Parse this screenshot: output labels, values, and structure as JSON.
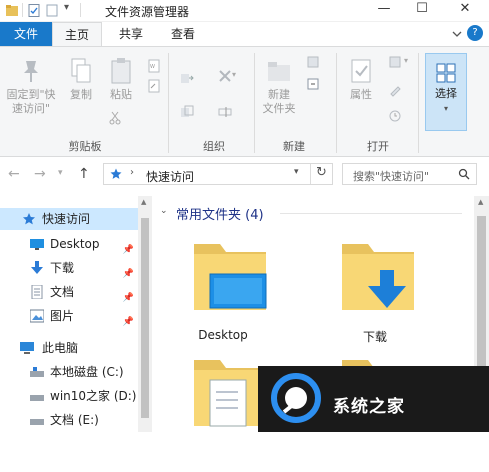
{
  "window": {
    "title": "文件资源管理器",
    "minimize": "—",
    "maximize": "☐",
    "close": "✕"
  },
  "tabs": {
    "file": "文件",
    "home": "主页",
    "share": "共享",
    "view": "查看",
    "help": "?"
  },
  "ribbon": {
    "clipboard": {
      "pin_label_1": "固定到\"快",
      "pin_label_2": "速访问\"",
      "copy_label": "复制",
      "paste_label": "粘贴",
      "group_label": "剪贴板"
    },
    "organize": {
      "group_label": "组织"
    },
    "new": {
      "new_folder_label_1": "新建",
      "new_folder_label_2": "文件夹",
      "group_label": "新建"
    },
    "open": {
      "properties_label": "属性",
      "group_label": "打开"
    },
    "select": {
      "select_label": "选择"
    }
  },
  "address": {
    "path": "快速访问",
    "search_placeholder": "搜索\"快速访问\""
  },
  "nav_pane": {
    "items": [
      {
        "label": "快速访问",
        "icon": "star-icon",
        "pinned": false
      },
      {
        "label": "Desktop",
        "icon": "desktop-icon",
        "pinned": true
      },
      {
        "label": "下载",
        "icon": "download-icon",
        "pinned": true
      },
      {
        "label": "文档",
        "icon": "document-icon",
        "pinned": true
      },
      {
        "label": "图片",
        "icon": "picture-icon",
        "pinned": true
      },
      {
        "label": "此电脑",
        "icon": "computer-icon",
        "pinned": false
      },
      {
        "label": "本地磁盘 (C:)",
        "icon": "drive-icon",
        "pinned": false
      },
      {
        "label": "win10之家 (D:)",
        "icon": "drive-icon",
        "pinned": false
      },
      {
        "label": "文档 (E:)",
        "icon": "drive-icon",
        "pinned": false
      }
    ]
  },
  "content": {
    "group_header": "常用文件夹 (4)",
    "folders": [
      {
        "label": "Desktop",
        "icon": "desktop-folder-icon"
      },
      {
        "label": "下载",
        "icon": "download-folder-icon"
      },
      {
        "label": "",
        "icon": "documents-folder-icon"
      },
      {
        "label": "",
        "icon": "pictures-folder-icon"
      }
    ]
  },
  "watermark": {
    "text": "系统之家"
  },
  "colors": {
    "accent": "#1979ca",
    "ribbon_bg": "#f5f6f7",
    "folder": "#f8d775",
    "selection": "#cce4f7",
    "group_header": "#1e3287"
  }
}
